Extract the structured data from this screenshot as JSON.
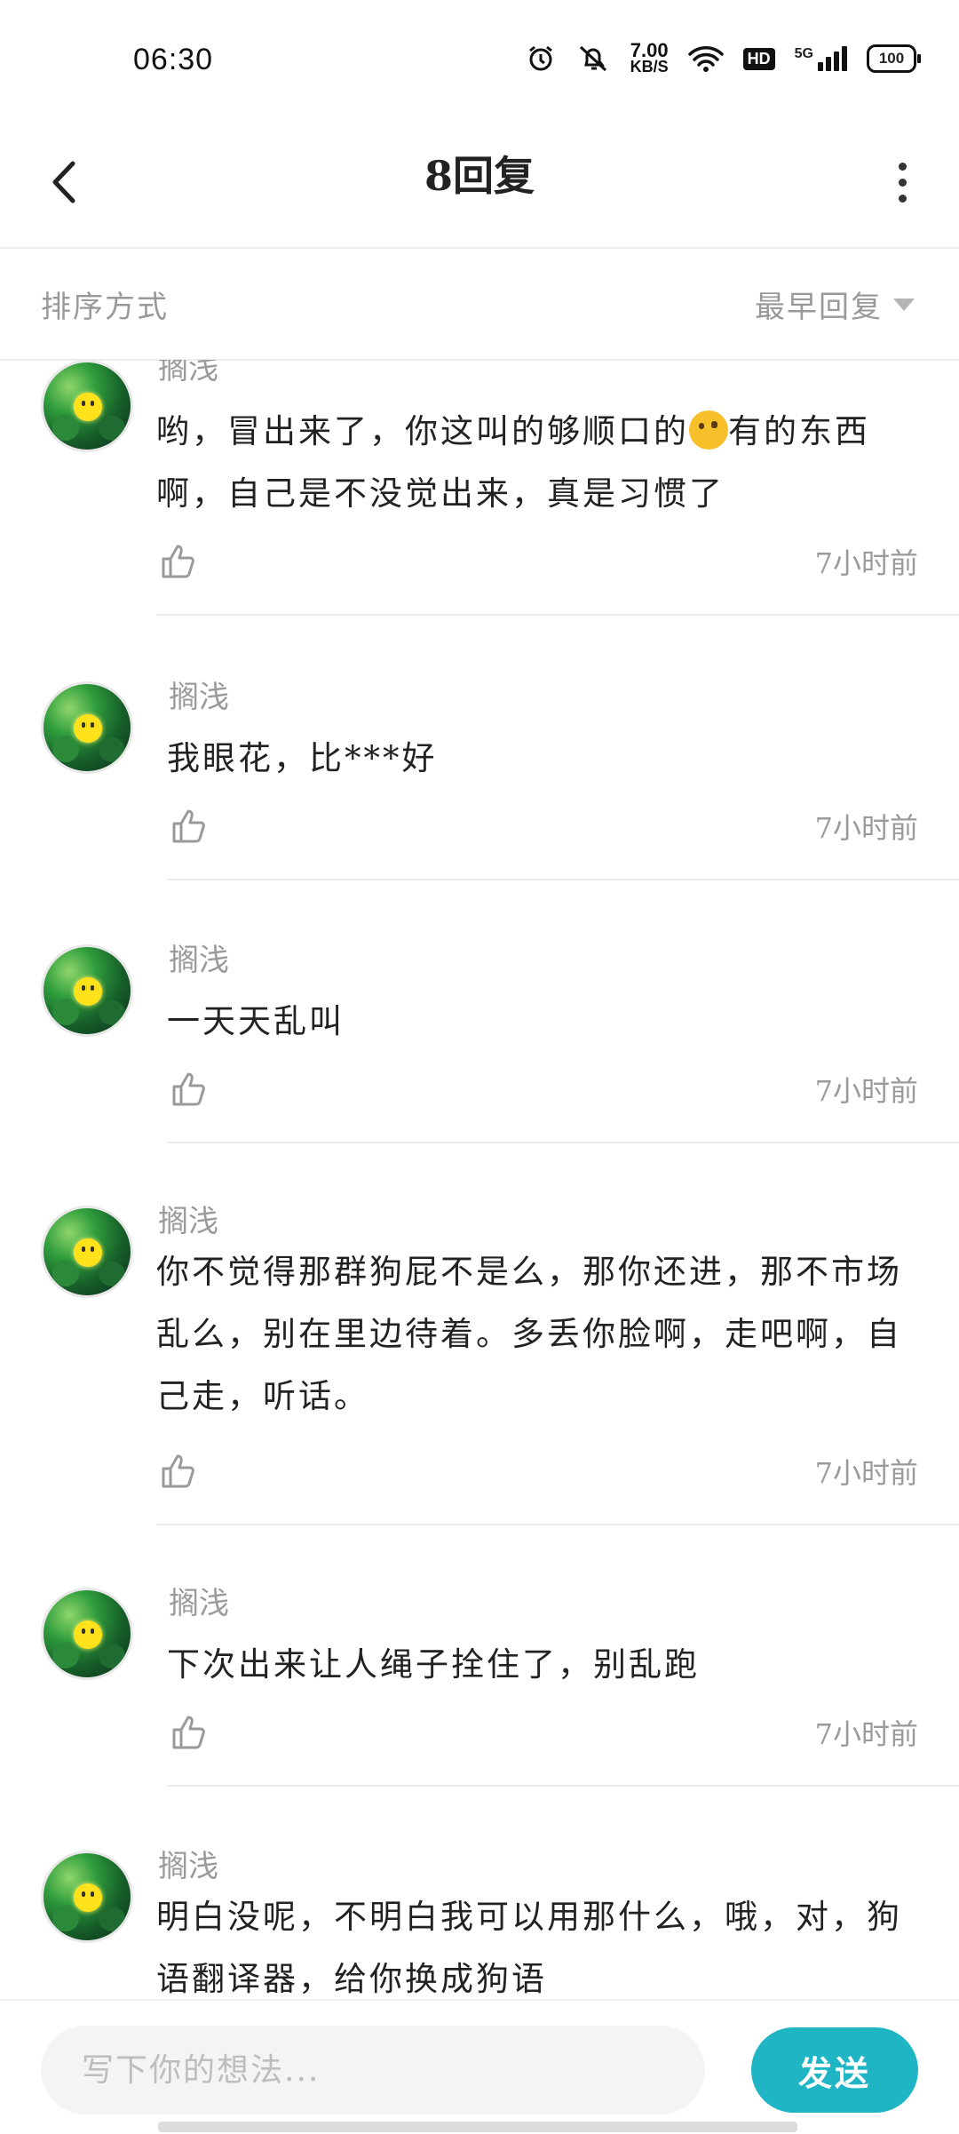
{
  "status": {
    "time": "06:30",
    "speed_value": "7.00",
    "speed_unit": "KB/S",
    "hd": "HD",
    "network": "5G",
    "battery": "100"
  },
  "header": {
    "title": "8回复"
  },
  "sort": {
    "label": "排序方式",
    "selected": "最早回复"
  },
  "replies": [
    {
      "user": "搁浅",
      "text_a": "哟，冒出来了，你这叫的够顺口的",
      "emoji": "thinking-face-emoji",
      "text_b": "有的东西啊，自己是不没觉出来，真是习惯了",
      "time": "7小时前"
    },
    {
      "user": "搁浅",
      "text": "我眼花，比***好",
      "time": "7小时前"
    },
    {
      "user": "搁浅",
      "text": "一天天乱叫",
      "time": "7小时前"
    },
    {
      "user": "搁浅",
      "text": "你不觉得那群狗屁不是么，那你还进，那不市场乱么，别在里边待着。多丢你脸啊，走吧啊，自己走，听话。",
      "time": "7小时前"
    },
    {
      "user": "搁浅",
      "text": "下次出来让人绳子拴住了，别乱跑",
      "time": "7小时前"
    },
    {
      "user": "搁浅",
      "text": "明白没呢，不明白我可以用那什么，哦，对，狗语翻译器，给你换成狗语",
      "time": ""
    }
  ],
  "composer": {
    "placeholder": "写下你的想法...",
    "send_label": "发送"
  },
  "colors": {
    "accent": "#1fb5c4",
    "muted_text": "#9a9a9a",
    "divider": "#ececec"
  }
}
